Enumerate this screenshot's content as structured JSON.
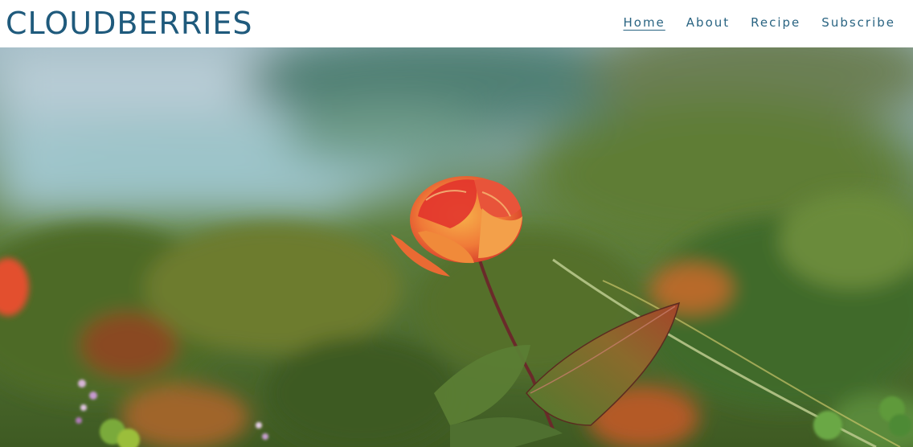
{
  "header": {
    "logo": "CLOUDBERRIES",
    "nav": [
      {
        "label": "Home",
        "active": true
      },
      {
        "label": "About",
        "active": false
      },
      {
        "label": "Recipe",
        "active": false
      },
      {
        "label": "Subscribe",
        "active": false
      }
    ]
  },
  "colors": {
    "brand": "#1f5a7c",
    "nav_text": "#2a6482"
  },
  "hero": {
    "image": "cloudberry-flower-photo"
  }
}
